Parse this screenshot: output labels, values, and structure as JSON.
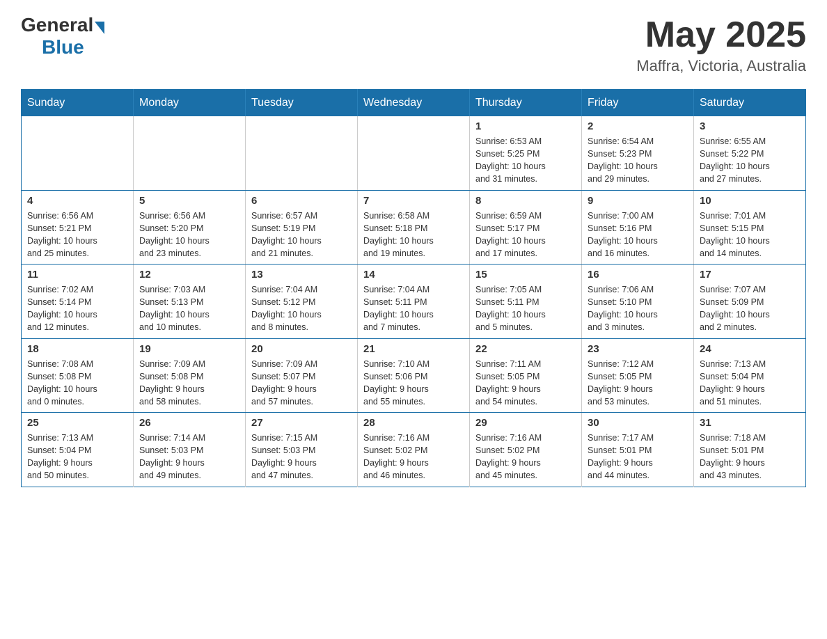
{
  "logo": {
    "general": "General",
    "blue": "Blue"
  },
  "title": {
    "month_year": "May 2025",
    "location": "Maffra, Victoria, Australia"
  },
  "headers": [
    "Sunday",
    "Monday",
    "Tuesday",
    "Wednesday",
    "Thursday",
    "Friday",
    "Saturday"
  ],
  "weeks": [
    [
      {
        "day": "",
        "info": ""
      },
      {
        "day": "",
        "info": ""
      },
      {
        "day": "",
        "info": ""
      },
      {
        "day": "",
        "info": ""
      },
      {
        "day": "1",
        "info": "Sunrise: 6:53 AM\nSunset: 5:25 PM\nDaylight: 10 hours\nand 31 minutes."
      },
      {
        "day": "2",
        "info": "Sunrise: 6:54 AM\nSunset: 5:23 PM\nDaylight: 10 hours\nand 29 minutes."
      },
      {
        "day": "3",
        "info": "Sunrise: 6:55 AM\nSunset: 5:22 PM\nDaylight: 10 hours\nand 27 minutes."
      }
    ],
    [
      {
        "day": "4",
        "info": "Sunrise: 6:56 AM\nSunset: 5:21 PM\nDaylight: 10 hours\nand 25 minutes."
      },
      {
        "day": "5",
        "info": "Sunrise: 6:56 AM\nSunset: 5:20 PM\nDaylight: 10 hours\nand 23 minutes."
      },
      {
        "day": "6",
        "info": "Sunrise: 6:57 AM\nSunset: 5:19 PM\nDaylight: 10 hours\nand 21 minutes."
      },
      {
        "day": "7",
        "info": "Sunrise: 6:58 AM\nSunset: 5:18 PM\nDaylight: 10 hours\nand 19 minutes."
      },
      {
        "day": "8",
        "info": "Sunrise: 6:59 AM\nSunset: 5:17 PM\nDaylight: 10 hours\nand 17 minutes."
      },
      {
        "day": "9",
        "info": "Sunrise: 7:00 AM\nSunset: 5:16 PM\nDaylight: 10 hours\nand 16 minutes."
      },
      {
        "day": "10",
        "info": "Sunrise: 7:01 AM\nSunset: 5:15 PM\nDaylight: 10 hours\nand 14 minutes."
      }
    ],
    [
      {
        "day": "11",
        "info": "Sunrise: 7:02 AM\nSunset: 5:14 PM\nDaylight: 10 hours\nand 12 minutes."
      },
      {
        "day": "12",
        "info": "Sunrise: 7:03 AM\nSunset: 5:13 PM\nDaylight: 10 hours\nand 10 minutes."
      },
      {
        "day": "13",
        "info": "Sunrise: 7:04 AM\nSunset: 5:12 PM\nDaylight: 10 hours\nand 8 minutes."
      },
      {
        "day": "14",
        "info": "Sunrise: 7:04 AM\nSunset: 5:11 PM\nDaylight: 10 hours\nand 7 minutes."
      },
      {
        "day": "15",
        "info": "Sunrise: 7:05 AM\nSunset: 5:11 PM\nDaylight: 10 hours\nand 5 minutes."
      },
      {
        "day": "16",
        "info": "Sunrise: 7:06 AM\nSunset: 5:10 PM\nDaylight: 10 hours\nand 3 minutes."
      },
      {
        "day": "17",
        "info": "Sunrise: 7:07 AM\nSunset: 5:09 PM\nDaylight: 10 hours\nand 2 minutes."
      }
    ],
    [
      {
        "day": "18",
        "info": "Sunrise: 7:08 AM\nSunset: 5:08 PM\nDaylight: 10 hours\nand 0 minutes."
      },
      {
        "day": "19",
        "info": "Sunrise: 7:09 AM\nSunset: 5:08 PM\nDaylight: 9 hours\nand 58 minutes."
      },
      {
        "day": "20",
        "info": "Sunrise: 7:09 AM\nSunset: 5:07 PM\nDaylight: 9 hours\nand 57 minutes."
      },
      {
        "day": "21",
        "info": "Sunrise: 7:10 AM\nSunset: 5:06 PM\nDaylight: 9 hours\nand 55 minutes."
      },
      {
        "day": "22",
        "info": "Sunrise: 7:11 AM\nSunset: 5:05 PM\nDaylight: 9 hours\nand 54 minutes."
      },
      {
        "day": "23",
        "info": "Sunrise: 7:12 AM\nSunset: 5:05 PM\nDaylight: 9 hours\nand 53 minutes."
      },
      {
        "day": "24",
        "info": "Sunrise: 7:13 AM\nSunset: 5:04 PM\nDaylight: 9 hours\nand 51 minutes."
      }
    ],
    [
      {
        "day": "25",
        "info": "Sunrise: 7:13 AM\nSunset: 5:04 PM\nDaylight: 9 hours\nand 50 minutes."
      },
      {
        "day": "26",
        "info": "Sunrise: 7:14 AM\nSunset: 5:03 PM\nDaylight: 9 hours\nand 49 minutes."
      },
      {
        "day": "27",
        "info": "Sunrise: 7:15 AM\nSunset: 5:03 PM\nDaylight: 9 hours\nand 47 minutes."
      },
      {
        "day": "28",
        "info": "Sunrise: 7:16 AM\nSunset: 5:02 PM\nDaylight: 9 hours\nand 46 minutes."
      },
      {
        "day": "29",
        "info": "Sunrise: 7:16 AM\nSunset: 5:02 PM\nDaylight: 9 hours\nand 45 minutes."
      },
      {
        "day": "30",
        "info": "Sunrise: 7:17 AM\nSunset: 5:01 PM\nDaylight: 9 hours\nand 44 minutes."
      },
      {
        "day": "31",
        "info": "Sunrise: 7:18 AM\nSunset: 5:01 PM\nDaylight: 9 hours\nand 43 minutes."
      }
    ]
  ]
}
